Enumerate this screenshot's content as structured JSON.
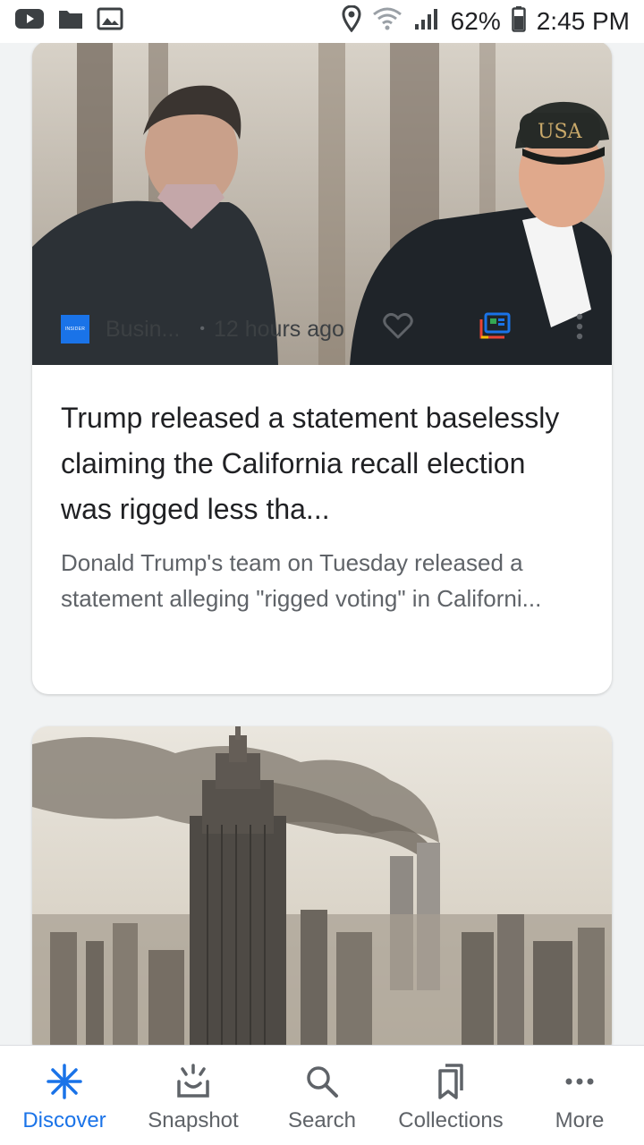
{
  "status_bar": {
    "battery_percent": "62%",
    "time": "2:45 PM"
  },
  "cards": [
    {
      "headline": "Trump released a statement baselessly claiming the California recall election was rigged less tha...",
      "snippet": "Donald Trump's team on Tuesday released a statement alleging \"rigged voting\" in Californi...",
      "source_logo_text": "INSIDER",
      "source": "Busin...",
      "separator": "•",
      "time": "12 hours ago"
    }
  ],
  "bottom_nav": [
    {
      "label": "Discover",
      "icon": "discover-asterisk-icon",
      "active": true
    },
    {
      "label": "Snapshot",
      "icon": "snapshot-icon",
      "active": false
    },
    {
      "label": "Search",
      "icon": "search-icon",
      "active": false
    },
    {
      "label": "Collections",
      "icon": "collections-bookmark-icon",
      "active": false
    },
    {
      "label": "More",
      "icon": "more-dots-icon",
      "active": false
    }
  ],
  "colors": {
    "accent": "#1a73e8",
    "background": "#f1f3f4",
    "text_primary": "#202124",
    "text_secondary": "#5f6368"
  }
}
